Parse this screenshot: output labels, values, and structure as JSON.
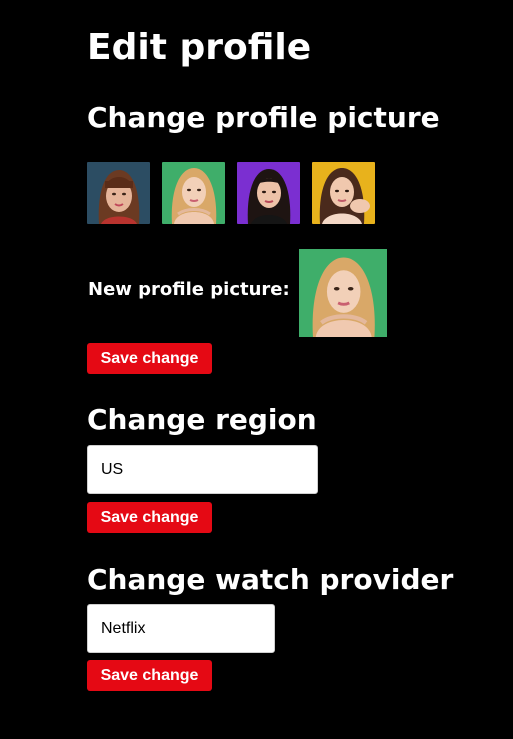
{
  "page": {
    "title": "Edit profile"
  },
  "profile_picture": {
    "heading": "Change profile picture",
    "options": [
      {
        "name": "avatar-option-1",
        "bg": "#2c4d63"
      },
      {
        "name": "avatar-option-2",
        "bg": "#3fae6a"
      },
      {
        "name": "avatar-option-3",
        "bg": "#7b2fd1"
      },
      {
        "name": "avatar-option-4",
        "bg": "#e8b21c"
      }
    ],
    "new_label": "New profile picture:",
    "save_label": "Save change"
  },
  "region": {
    "heading": "Change region",
    "value": "US",
    "save_label": "Save change"
  },
  "watch_provider": {
    "heading": "Change watch provider",
    "value": "Netflix",
    "save_label": "Save change"
  },
  "colors": {
    "background": "#000000",
    "accent": "#e50914",
    "text": "#ffffff"
  }
}
